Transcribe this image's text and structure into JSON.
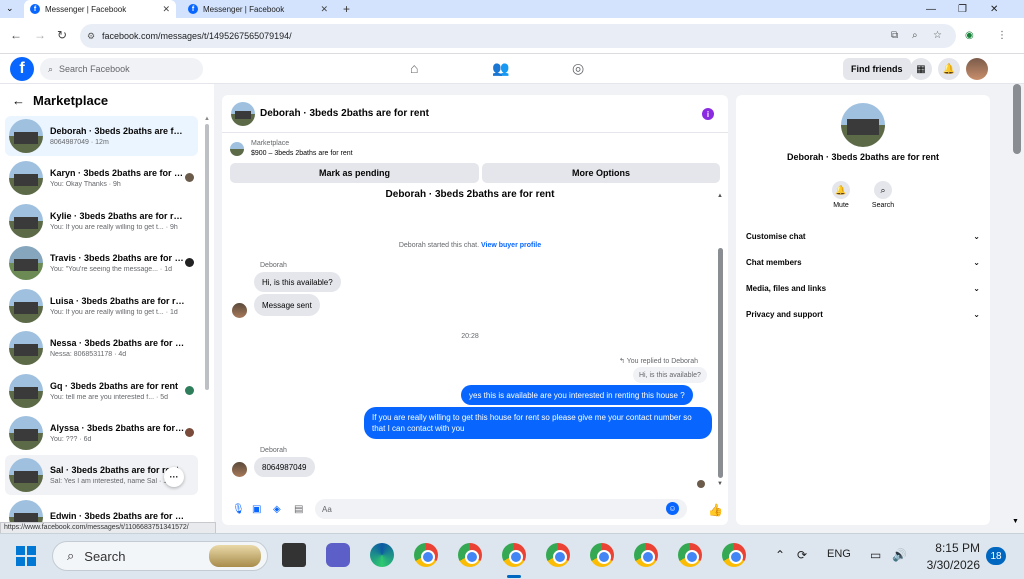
{
  "browser": {
    "tabs": [
      {
        "title": "Messenger | Facebook",
        "active": true
      },
      {
        "title": "Messenger | Facebook",
        "active": false
      }
    ],
    "url": "facebook.com/messages/t/1495267565079194/",
    "status_url": "https://www.facebook.com/messages/t/1106683751341572/"
  },
  "header": {
    "search_placeholder": "Search Facebook",
    "find_friends": "Find friends"
  },
  "sidebar": {
    "title": "Marketplace",
    "conversations": [
      {
        "name": "Deborah · 3beds 2baths are for rent",
        "last": "8064987049 · 12m",
        "selected": true
      },
      {
        "name": "Karyn · 3beds 2baths are for rent",
        "last": "You: Okay Thanks · 9h"
      },
      {
        "name": "Kylie · 3beds 2baths are for rent",
        "last": "You: If you are really willing to get t... · 9h"
      },
      {
        "name": "Travis · 3beds 2baths are for rent",
        "last": "You: \"You're seeing the message... · 1d"
      },
      {
        "name": "Luisa · 3beds 2baths are for rent",
        "last": "You: If you are really willing to get t... · 1d"
      },
      {
        "name": "Nessa · 3beds 2baths are for rent",
        "last": "Nessa: 8068531178 · 4d"
      },
      {
        "name": "Gq · 3beds 2baths are for rent",
        "last": "You: tell me are you interested f... · 5d"
      },
      {
        "name": "Alyssa · 3beds 2baths are for rent",
        "last": "You: ??? · 6d"
      },
      {
        "name": "Sal · 3beds 2baths are for rent",
        "last": "Sal: Yes I am interested, name Sal · 1w"
      },
      {
        "name": "Edwin · 3beds 2baths are for rent",
        "last": ""
      }
    ]
  },
  "chat": {
    "title": "Deborah · 3beds 2baths are for rent",
    "marketplace_label": "Marketplace",
    "listing_price": "$900 – 3beds 2baths are for rent",
    "mark_pending": "Mark as pending",
    "more_options": "More Options",
    "big_name": "Deborah · 3beds 2baths are for rent",
    "started_text": "Deborah started this chat.",
    "view_buyer_profile": "View buyer profile",
    "sender1": "Deborah",
    "msg1": "Hi, is this available?",
    "msg2": "Message sent",
    "timestamp": "20:28",
    "replied_label": "You replied to Deborah",
    "quoted": "Hi, is this available?",
    "out1": "yes this is available are you interested in renting this house ?",
    "out2": "If you are really willing to get this house for rent so please give me your contact number so that I  can contact with you",
    "sender2": "Deborah",
    "msg3": "8064987049",
    "composer_placeholder": "Aa"
  },
  "rightpanel": {
    "name": "Deborah · 3beds 2baths are for rent",
    "mute": "Mute",
    "search": "Search",
    "items": [
      "Customise chat",
      "Chat members",
      "Media, files and links",
      "Privacy and support"
    ]
  },
  "taskbar": {
    "search": "Search",
    "lang": "ENG",
    "time": "8:15 PM",
    "date": "3/30/2026",
    "notifications": "18"
  }
}
